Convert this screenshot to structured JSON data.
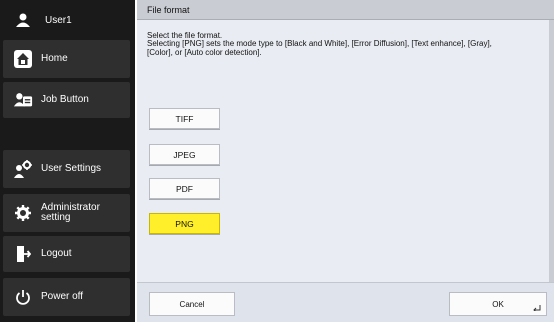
{
  "sidebar": {
    "user": {
      "label": "User1",
      "icon": "user-icon"
    },
    "items": [
      {
        "key": "home",
        "label": "Home",
        "icon": "home-icon"
      },
      {
        "key": "job",
        "label": "Job Button",
        "icon": "job-button-icon"
      },
      {
        "key": "user-settings",
        "label": "User Settings",
        "icon": "user-settings-icon"
      },
      {
        "key": "admin",
        "label": "Administrator\nsetting",
        "icon": "admin-gear-icon"
      },
      {
        "key": "logout",
        "label": "Logout",
        "icon": "logout-icon"
      },
      {
        "key": "power",
        "label": "Power off",
        "icon": "power-icon"
      }
    ]
  },
  "dialog": {
    "title": "File format",
    "description": "Select the file format.\nSelecting [PNG] sets the mode type to [Black and White], [Error Diffusion], [Text enhance], [Gray],\n[Color], or [Auto color detection].",
    "options": [
      {
        "label": "TIFF",
        "selected": false
      },
      {
        "label": "JPEG",
        "selected": false
      },
      {
        "label": "PDF",
        "selected": false
      },
      {
        "label": "PNG",
        "selected": true
      }
    ],
    "cancel_label": "Cancel",
    "ok_label": "OK"
  },
  "colors": {
    "selected": "#ffee2a",
    "sidebar_bg": "#1a1a1a",
    "sidebar_item": "#2f2f2f",
    "content_bg": "#e9ecf3"
  }
}
